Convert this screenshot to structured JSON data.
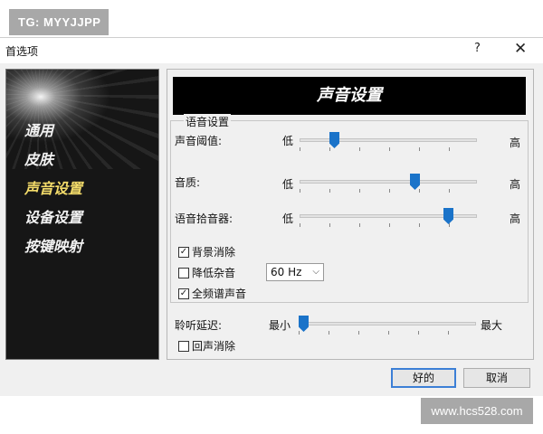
{
  "watermark_top": "TG: MYYJJPP",
  "watermark_bottom": "www.hcs528.com",
  "window": {
    "title": "首选项",
    "help": "?",
    "close": "✕"
  },
  "nav": {
    "items": [
      "通用",
      "皮肤",
      "声音设置",
      "设备设置",
      "按键映射"
    ],
    "active": "声音设置"
  },
  "banner": "声音设置",
  "voice_group": {
    "title": "语音设置",
    "sliders": [
      {
        "label": "声音阈值:",
        "min_label": "低",
        "max_label": "高",
        "value": 0.18
      },
      {
        "label": "音质:",
        "min_label": "低",
        "max_label": "高",
        "value": 0.66
      },
      {
        "label": "语音拾音器:",
        "min_label": "低",
        "max_label": "高",
        "value": 0.86
      }
    ],
    "checkboxes": [
      {
        "label": "背景消除",
        "checked": true
      },
      {
        "label": "降低杂音",
        "checked": false
      },
      {
        "label": "全频谱声音",
        "checked": true
      }
    ],
    "noise_select": "60 Hz"
  },
  "latency": {
    "label": "聆听延迟:",
    "min_label": "最小",
    "max_label": "最大",
    "value": 0.0
  },
  "echo_cancel": {
    "label": "回声消除",
    "checked": false
  },
  "buttons": {
    "ok": "好的",
    "cancel": "取消"
  }
}
